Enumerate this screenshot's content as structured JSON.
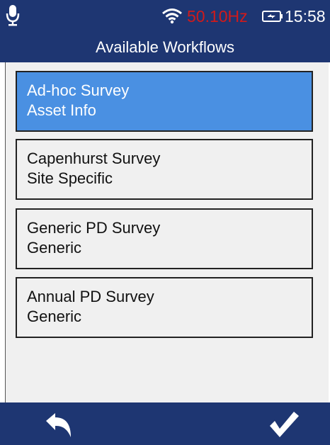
{
  "status_bar": {
    "frequency": "50.10Hz",
    "time": "15:58",
    "icons": [
      "microphone-icon",
      "wifi-icon",
      "battery-charging-icon"
    ]
  },
  "header": {
    "title": "Available Workflows"
  },
  "workflows": [
    {
      "name": "Ad-hoc Survey",
      "type": "Asset Info",
      "selected": true
    },
    {
      "name": "Capenhurst Survey",
      "type": "Site Specific",
      "selected": false
    },
    {
      "name": "Generic PD Survey",
      "type": "Generic",
      "selected": false
    },
    {
      "name": "Annual PD Survey",
      "type": "Generic",
      "selected": false
    }
  ],
  "footer": {
    "icons": [
      "back-arrow-icon",
      "checkmark-icon"
    ]
  },
  "colors": {
    "header_bg": "#1e3672",
    "selected_bg": "#4a90e2",
    "frequency_text": "#d11a1a",
    "list_bg": "#f0f0f0"
  }
}
